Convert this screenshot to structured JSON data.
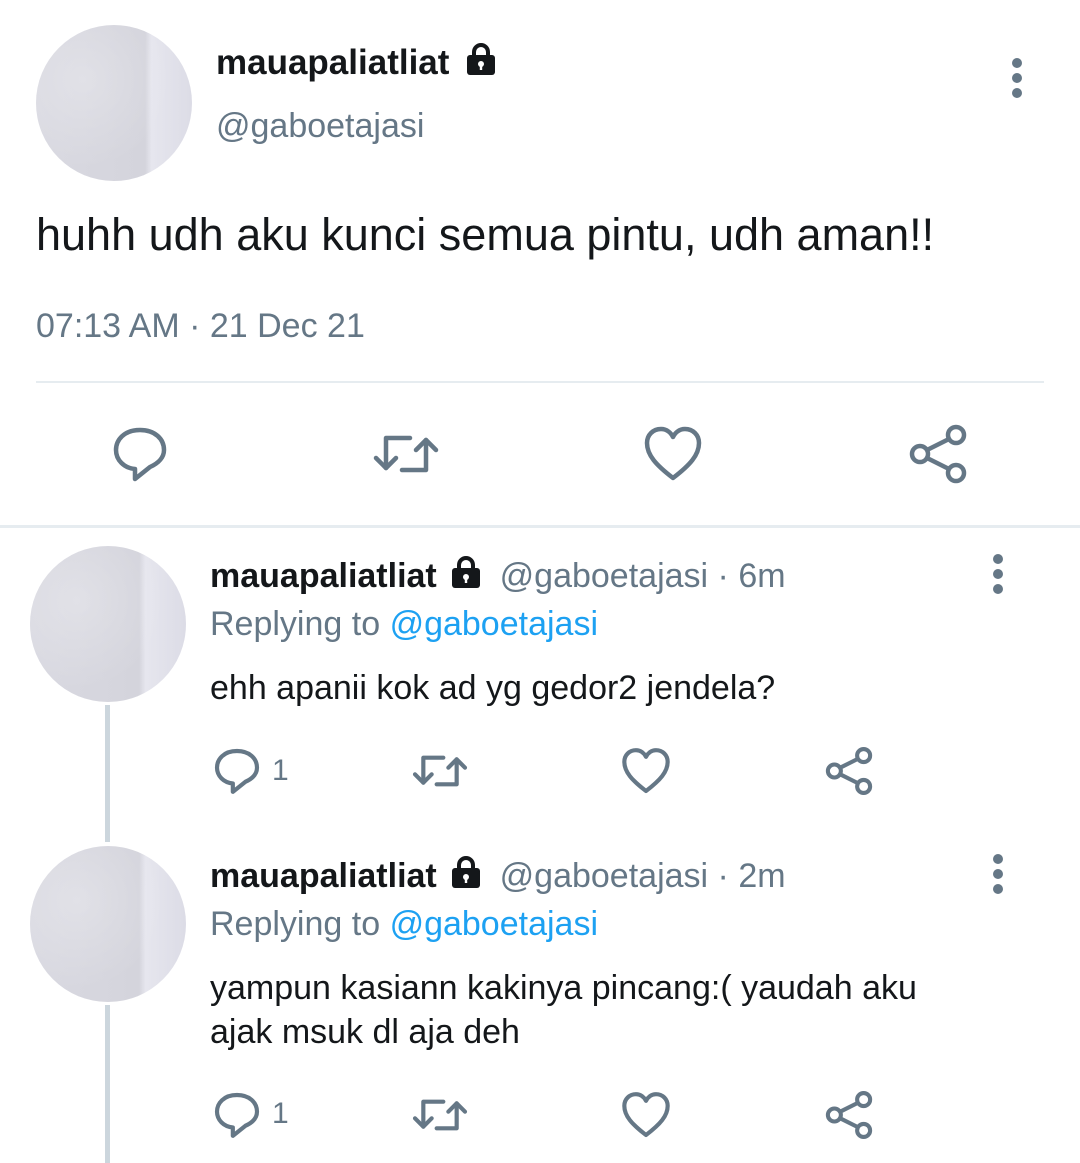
{
  "main_tweet": {
    "display_name": "mauapaliatliat",
    "handle": "@gaboetajasi",
    "text": "huhh udh aku kunci semua pintu, udh aman!!",
    "timestamp": "07:13 AM · 21 Dec 21",
    "actions": {
      "reply_icon": "reply-icon",
      "retweet_icon": "retweet-icon",
      "like_icon": "heart-icon",
      "share_icon": "share-icon"
    }
  },
  "replies": [
    {
      "display_name": "mauapaliatliat",
      "handle": "@gaboetajasi",
      "time": "· 6m",
      "replying_prefix": "Replying to",
      "replying_to": "@gaboetajasi",
      "text": "ehh apanii kok ad yg gedor2 jendela?",
      "reply_count": "1"
    },
    {
      "display_name": "mauapaliatliat",
      "handle": "@gaboetajasi",
      "time": "· 2m",
      "replying_prefix": "Replying to",
      "replying_to": "@gaboetajasi",
      "text_line1": "yampun kasiann kakinya pincang:( yaudah aku",
      "text_line2": "ajak msuk dl aja deh",
      "reply_count": "1"
    }
  ],
  "colors": {
    "text": "#14171a",
    "muted": "#657786",
    "link": "#1da1f2",
    "divider": "#e6ecf0"
  }
}
